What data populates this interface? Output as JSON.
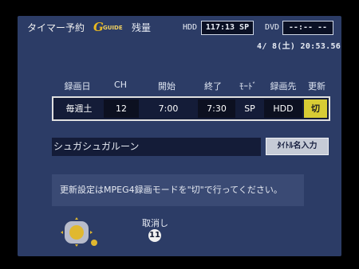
{
  "header": {
    "title": "タイマー予約",
    "guide_logo": {
      "letter": "G",
      "text": "GUIDE"
    },
    "remaining_label": "残量",
    "hdd_label": "HDD",
    "hdd_value": "117:13 SP",
    "dvd_label": "DVD",
    "dvd_value": "--:-- --",
    "datetime": "4/ 8(土) 20:53.56"
  },
  "columns": [
    "録画日",
    "CH",
    "開始",
    "終了",
    "ﾓｰﾄﾞ",
    "録画先",
    "更新"
  ],
  "timer_row": {
    "date": "毎週土",
    "channel": "12",
    "start": "7:00",
    "end": "7:30",
    "mode": "SP",
    "destination": "HDD",
    "update": "切"
  },
  "program_name": "シュガシュガルーン",
  "name_input_button": "ﾀｲﾄﾙ名入力",
  "notice": "更新設定はMPEG4録画モードを\"切\"で行ってください。",
  "footer": {
    "cancel_label": "取消し",
    "cancel_number": "11"
  },
  "colors": {
    "panel": "#2c3c66",
    "highlight": "#d8cc34",
    "cell_dark": "#0c1020",
    "dpad": "#e0b830"
  },
  "icons": [
    "guide-logo-icon",
    "dpad-icon",
    "circled-11-icon"
  ]
}
